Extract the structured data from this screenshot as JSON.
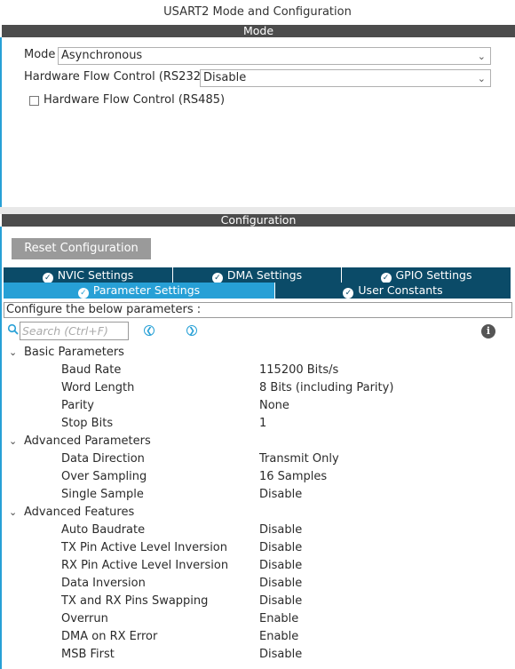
{
  "window": {
    "title": "USART2 Mode and Configuration"
  },
  "mode": {
    "header": "Mode",
    "mode_label": "Mode",
    "mode_value": "Asynchronous",
    "hfc232_label": "Hardware Flow Control (RS232)",
    "hfc232_value": "Disable",
    "hfc485_label": "Hardware Flow Control (RS485)",
    "hfc485_checked": false
  },
  "configuration": {
    "header": "Configuration",
    "reset_button": "Reset Configuration",
    "tabs_row1": [
      {
        "label": "NVIC Settings"
      },
      {
        "label": "DMA Settings"
      },
      {
        "label": "GPIO Settings"
      }
    ],
    "tabs_row2": [
      {
        "label": "Parameter Settings",
        "active": true
      },
      {
        "label": "User Constants",
        "active": false
      }
    ],
    "description": "Configure the below parameters :",
    "search_placeholder": "Search (Ctrl+F)",
    "groups": [
      {
        "label": "Basic Parameters",
        "params": [
          {
            "name": "Baud Rate",
            "value": "115200 Bits/s"
          },
          {
            "name": "Word Length",
            "value": "8 Bits (including Parity)"
          },
          {
            "name": "Parity",
            "value": "None"
          },
          {
            "name": "Stop Bits",
            "value": "1"
          }
        ]
      },
      {
        "label": "Advanced Parameters",
        "params": [
          {
            "name": "Data Direction",
            "value": "Transmit Only"
          },
          {
            "name": "Over Sampling",
            "value": "16 Samples"
          },
          {
            "name": "Single Sample",
            "value": "Disable"
          }
        ]
      },
      {
        "label": "Advanced Features",
        "params": [
          {
            "name": "Auto Baudrate",
            "value": "Disable"
          },
          {
            "name": "TX Pin Active Level Inversion",
            "value": "Disable"
          },
          {
            "name": "RX Pin Active Level Inversion",
            "value": "Disable"
          },
          {
            "name": "Data Inversion",
            "value": "Disable"
          },
          {
            "name": "TX and RX Pins Swapping",
            "value": "Disable"
          },
          {
            "name": "Overrun",
            "value": "Enable"
          },
          {
            "name": "DMA on RX Error",
            "value": "Enable"
          },
          {
            "name": "MSB First",
            "value": "Disable"
          }
        ]
      }
    ]
  },
  "icons": {
    "tab_check": "check-circle-icon",
    "search": "search-icon",
    "prev": "chevron-left-icon",
    "next": "chevron-right-icon",
    "info": "info-icon",
    "expand": "chevron-down-icon",
    "dropdown": "chevron-down-icon"
  },
  "colors": {
    "accent": "#27a0d6",
    "tab_dark": "#0b4b68",
    "section_bar": "#4c4c4c",
    "button": "#9a9a9a"
  }
}
